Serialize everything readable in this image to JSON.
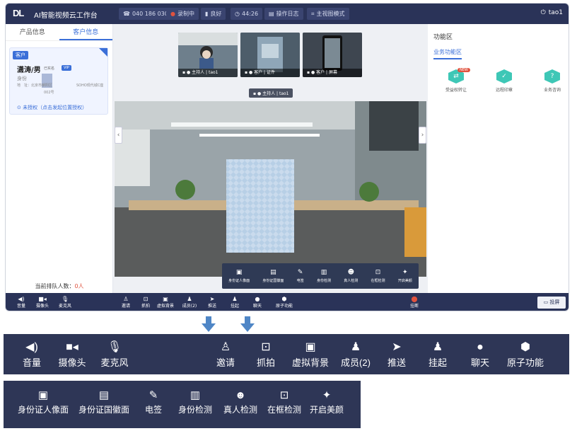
{
  "app": {
    "logo": "DL",
    "title": "AI智能视频云工作台",
    "status": [
      {
        "icon": "phone-icon",
        "text": "040 186 030"
      },
      {
        "icon": "record-dot-icon",
        "text": "录制中"
      },
      {
        "icon": "signal-icon",
        "text": "良好"
      },
      {
        "icon": "clock-icon",
        "text": "44:26"
      },
      {
        "icon": "log-icon",
        "text": "操作日志"
      },
      {
        "icon": "layout-icon",
        "text": "主视图模式"
      }
    ],
    "user": "tao1",
    "colors": {
      "topbar": "#2a3358",
      "accent": "#3b6fd8",
      "teal": "#3ec7b6",
      "alert": "#e0533f"
    }
  },
  "left": {
    "tabs": [
      "产品信息",
      "客户信息"
    ],
    "active_tab": 1,
    "customer": {
      "badge": "客户",
      "name": "潇涛/男",
      "verify_label": "已实名",
      "tag": "VIP",
      "line1": "身份",
      "line2": "地　址：北京市朝阳区",
      "line2b": "SOHO现代城C座",
      "line3": "002号",
      "locate": "未授权（点击发起位置授权）"
    },
    "queue_label": "当前排队人数：",
    "queue_value": "0人"
  },
  "thumbs": [
    {
      "label": "主持人 | tao1"
    },
    {
      "label": "客户 | 证件"
    },
    {
      "label": "客户 | 屏幕"
    }
  ],
  "main_label": "主持人 | tao1",
  "video_tools": [
    {
      "icon": "id-portrait-icon",
      "label": "身份证人像面"
    },
    {
      "icon": "id-emblem-icon",
      "label": "身份证国徽面"
    },
    {
      "icon": "signature-icon",
      "label": "电签"
    },
    {
      "icon": "id-check-icon",
      "label": "身份检测"
    },
    {
      "icon": "person-check-icon",
      "label": "真人检测"
    },
    {
      "icon": "frame-check-icon",
      "label": "在框检测"
    },
    {
      "icon": "magic-wand-icon",
      "label": "开启美颜"
    }
  ],
  "right": {
    "title": "功能区",
    "tab": "业务功能区",
    "features": [
      {
        "label": "受益权转让",
        "hot": "NEW"
      },
      {
        "label": "远程印章",
        "hot": ""
      },
      {
        "label": "业务咨询",
        "hot": ""
      }
    ]
  },
  "bottom_bar": {
    "left": [
      {
        "icon": "volume-icon",
        "label": "音量"
      },
      {
        "icon": "camera-icon",
        "label": "摄像头"
      },
      {
        "icon": "microphone-icon",
        "label": "麦克风"
      }
    ],
    "middle": [
      {
        "icon": "invite-icon",
        "label": "邀请"
      },
      {
        "icon": "capture-icon",
        "label": "抓拍"
      },
      {
        "icon": "virtual-bg-icon",
        "label": "虚拟背景"
      },
      {
        "icon": "members-icon",
        "label": "成员(2)"
      },
      {
        "icon": "send-icon",
        "label": "推送"
      },
      {
        "icon": "hold-icon",
        "label": "挂起"
      },
      {
        "icon": "chat-icon",
        "label": "聊天"
      },
      {
        "icon": "atom-icon",
        "label": "原子功能"
      }
    ],
    "hangup": "挂断",
    "share": "投屏"
  },
  "bar1": {
    "left": [
      {
        "icon": "volume-icon",
        "label": "音量"
      },
      {
        "icon": "camera-icon",
        "label": "摄像头"
      },
      {
        "icon": "microphone-icon",
        "label": "麦克风"
      }
    ],
    "right": [
      {
        "icon": "invite-icon",
        "label": "邀请"
      },
      {
        "icon": "capture-icon",
        "label": "抓拍"
      },
      {
        "icon": "virtual-bg-icon",
        "label": "虚拟背景"
      },
      {
        "icon": "members-icon",
        "label": "成员(2)"
      },
      {
        "icon": "send-icon",
        "label": "推送"
      },
      {
        "icon": "hold-icon",
        "label": "挂起"
      },
      {
        "icon": "chat-icon",
        "label": "聊天"
      },
      {
        "icon": "atom-icon",
        "label": "原子功能"
      }
    ]
  },
  "bar2": [
    {
      "icon": "id-portrait-icon",
      "label": "身份证人像面"
    },
    {
      "icon": "id-emblem-icon",
      "label": "身份证国徽面"
    },
    {
      "icon": "signature-icon",
      "label": "电签"
    },
    {
      "icon": "id-check-icon",
      "label": "身份检测"
    },
    {
      "icon": "person-check-icon",
      "label": "真人检测"
    },
    {
      "icon": "frame-check-icon",
      "label": "在框检测"
    },
    {
      "icon": "magic-wand-icon",
      "label": "开启美颜"
    }
  ]
}
